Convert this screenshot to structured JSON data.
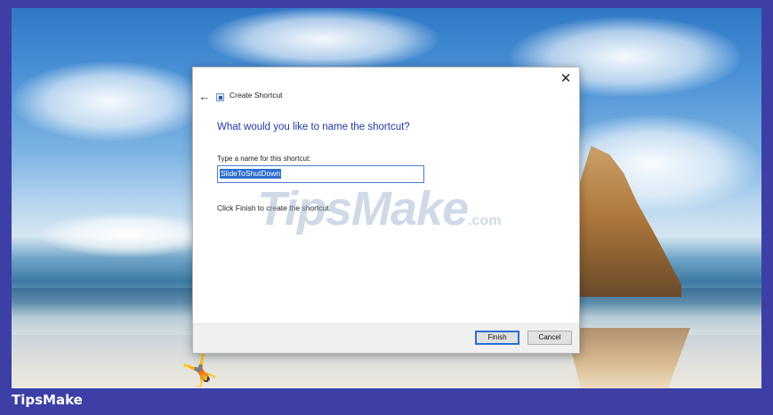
{
  "dialog": {
    "title": "Create Shortcut",
    "heading": "What would you like to name the shortcut?",
    "field_label": "Type a name for this shortcut:",
    "name_value": "SlideToShutDown",
    "hint": "Click Finish to create the shortcut.",
    "finish_label": "Finish",
    "cancel_label": "Cancel",
    "close_glyph": "✕",
    "back_glyph": "←"
  },
  "watermark": {
    "main": "TipsMake",
    "suffix": ".com"
  },
  "brand": {
    "label": "TipsMake"
  },
  "colors": {
    "frame": "#3d3fa6",
    "heading": "#1f3aa0",
    "selection": "#2e6fd0"
  },
  "icons": {
    "back": "back-arrow-icon",
    "title": "shortcut-icon",
    "close": "close-icon"
  }
}
